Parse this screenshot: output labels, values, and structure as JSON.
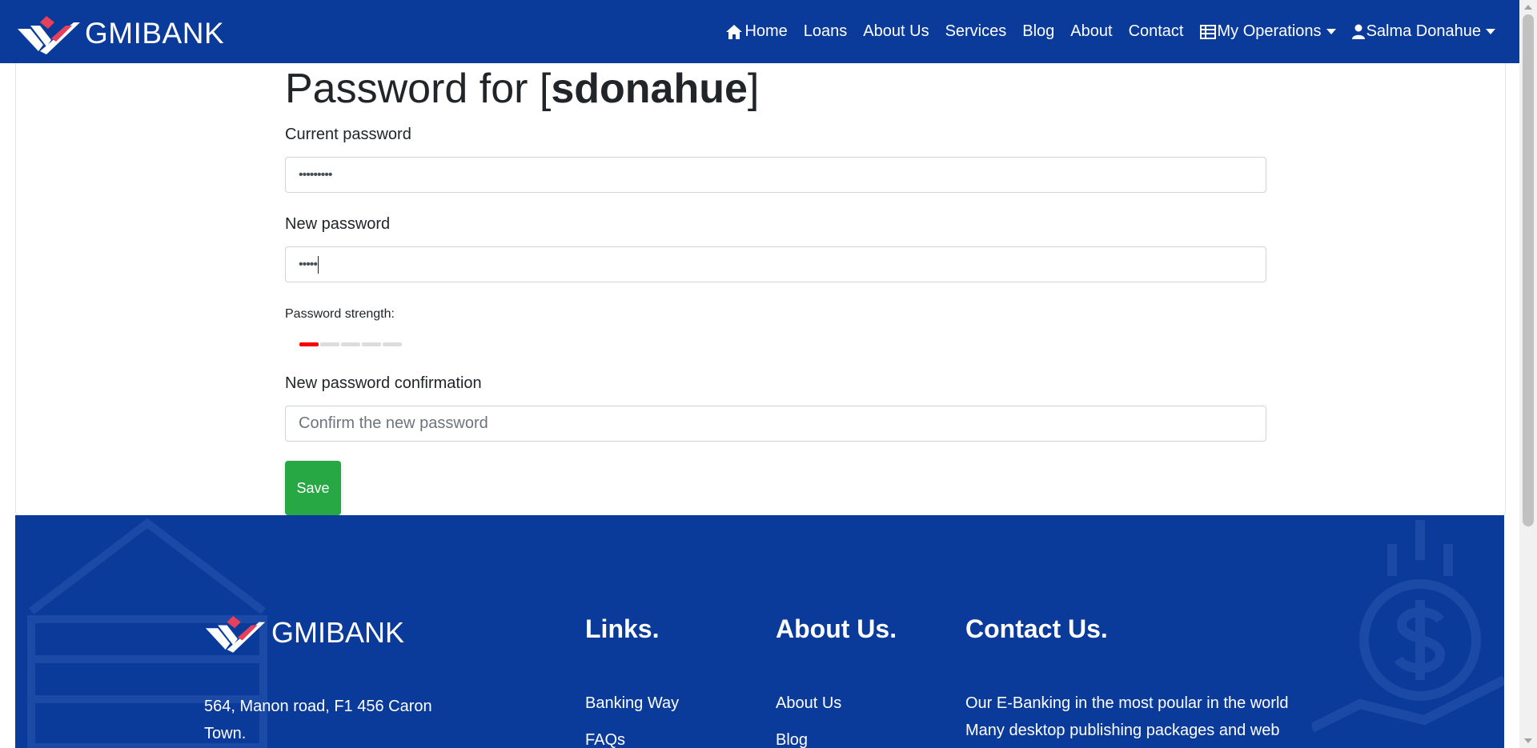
{
  "navbar": {
    "brand": "GMIBANK",
    "items": [
      {
        "label": "Home",
        "icon": "home-icon"
      },
      {
        "label": "Loans"
      },
      {
        "label": "About Us"
      },
      {
        "label": "Services"
      },
      {
        "label": "Blog"
      },
      {
        "label": "About"
      },
      {
        "label": "Contact"
      },
      {
        "label": "My Operations",
        "icon": "table-icon"
      },
      {
        "label": "Salma Donahue",
        "icon": "user-icon"
      }
    ]
  },
  "form": {
    "title_prefix": "Password for [",
    "username": "sdonahue",
    "title_suffix": "]",
    "current_label": "Current password",
    "current_value": "•••••••••",
    "new_label": "New password",
    "new_value": "•••••",
    "strength_label": "Password strength:",
    "strength_level": 1,
    "strength_max": 5,
    "confirm_label": "New password confirmation",
    "confirm_placeholder": "Confirm the new password",
    "save_label": "Save"
  },
  "footer": {
    "brand": "GMIBANK",
    "address": "564, Manon road, F1 456 Caron Town.",
    "links_heading": "Links.",
    "links": [
      "Banking Way",
      "FAQs"
    ],
    "about_heading": "About Us.",
    "about_links": [
      "About Us",
      "Blog"
    ],
    "contact_heading": "Contact Us.",
    "contact_text": "Our E-Banking in the most poular in the world Many desktop publishing packages and web"
  },
  "colors": {
    "primary": "#0a3b9b",
    "accent": "#e6405a",
    "save": "#28a745",
    "strength_active": "#ff0000"
  }
}
